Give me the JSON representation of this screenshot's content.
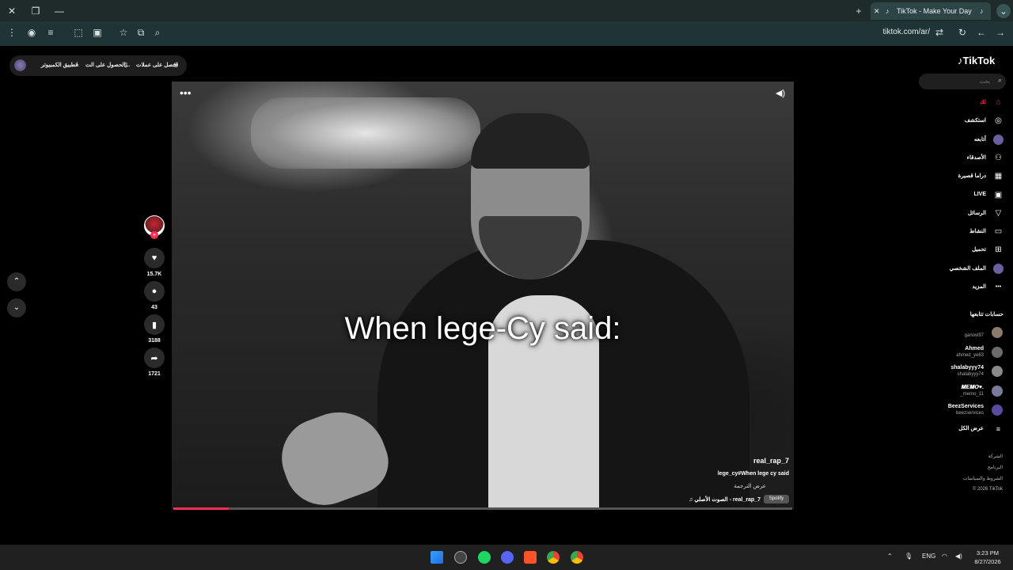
{
  "browser": {
    "tab_title": "TikTok - Make Your Day",
    "url": "tiktok.com/ar/"
  },
  "topbar": {
    "items": [
      "احصل على عملات",
      "الحصول على الت...",
      "تطبيق الكمبيوتر"
    ]
  },
  "video": {
    "caption": "When lege-Cy said:",
    "username": "real_rap_7",
    "description": "lege_cy#When lege cy said",
    "translate_label": "عرض الترجمة",
    "music": "الصوت الأصلي - real_rap_7",
    "music_chip": "Spotify",
    "progress": 0.09
  },
  "actions": {
    "likes": "15.7K",
    "comments": "43",
    "saves": "3188",
    "shares": "1721"
  },
  "sidebar": {
    "logo": "TikTok",
    "search_placeholder": "بحث",
    "nav": [
      {
        "label": "لك",
        "icon": "home-icon"
      },
      {
        "label": "استكشف",
        "icon": "compass-icon"
      },
      {
        "label": "أتابعه",
        "icon": "following-icon"
      },
      {
        "label": "الأصدقاء",
        "icon": "friends-icon"
      },
      {
        "label": "دراما قصيرة",
        "icon": "drama-icon"
      },
      {
        "label": "LIVE",
        "icon": "live-icon"
      },
      {
        "label": "الرسائل",
        "icon": "send-icon"
      },
      {
        "label": "النشاط",
        "icon": "activity-icon"
      },
      {
        "label": "تحميل",
        "icon": "upload-icon"
      },
      {
        "label": "الملف الشخصي",
        "icon": "profile-icon"
      },
      {
        "label": "المزيد",
        "icon": "more-icon"
      }
    ],
    "following_title": "حسابات تتابعها",
    "following": [
      {
        "name": "",
        "handle": "ganovi97"
      },
      {
        "name": "Ahmed",
        "handle": "ahmed_ye63"
      },
      {
        "name": "shalabyyy74",
        "handle": "shalabyyy74"
      },
      {
        "name": "𝑴𝑬𝑴𝑶♥.",
        "handle": "_memo_11"
      },
      {
        "name": "BeezServices",
        "handle": "beezservices"
      }
    ],
    "see_all": "عرض الكل",
    "footer": [
      "الشركة",
      "البرنامج",
      "الشروط والسياسات",
      "© 2026 TikTok"
    ]
  },
  "taskbar": {
    "lang": "ENG",
    "time": "3:23 PM",
    "date": "8/27/2026"
  }
}
